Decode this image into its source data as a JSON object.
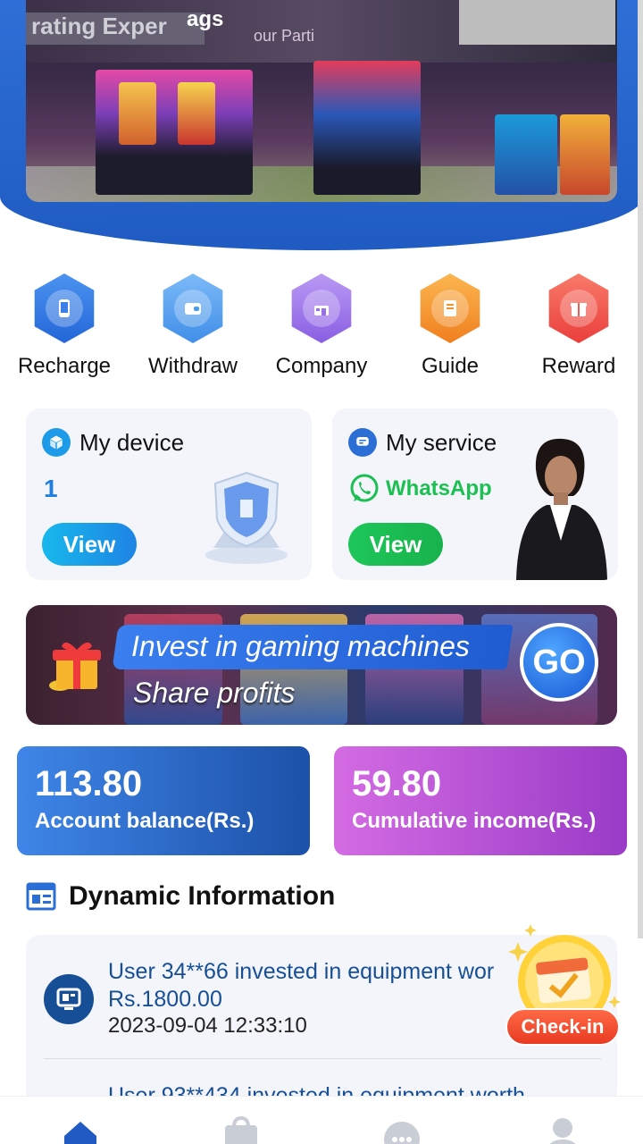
{
  "hero": {
    "sign_left": "rating Exper",
    "sign_mid": "ags",
    "sign_right": "our Parti"
  },
  "actions": [
    {
      "label": "Recharge",
      "icon": "phone-icon",
      "color": "#2f7de8"
    },
    {
      "label": "Withdraw",
      "icon": "wallet-icon",
      "color": "#4b9bf0"
    },
    {
      "label": "Company",
      "icon": "building-icon",
      "color": "#9a6ee8"
    },
    {
      "label": "Guide",
      "icon": "book-icon",
      "color": "#f5922b"
    },
    {
      "label": "Reward",
      "icon": "gift-icon",
      "color": "#f25a52"
    }
  ],
  "device_card": {
    "title": "My device",
    "count": "1",
    "button": "View"
  },
  "service_card": {
    "title": "My service",
    "channel": "WhatsApp",
    "button": "View"
  },
  "promo": {
    "line1": "Invest in gaming machines",
    "line2": "Share profits",
    "go": "GO"
  },
  "stats": {
    "balance_value": "113.80",
    "balance_label": "Account balance(Rs.)",
    "income_value": "59.80",
    "income_label": "Cumulative income(Rs.)"
  },
  "dynamic": {
    "title": "Dynamic Information",
    "items": [
      {
        "text": "User 34**66 invested in equipment wor",
        "amount": "Rs.1800.00",
        "time": "2023-09-04 12:33:10"
      },
      {
        "text": "User 93**434 invested in equipment worth"
      }
    ]
  },
  "checkin": {
    "label": "Check-in"
  },
  "nav": [
    "home-icon",
    "bag-icon",
    "chat-icon",
    "profile-icon"
  ],
  "colors": {
    "primary": "#1f5bc2",
    "accent_blue": "#1e9be8",
    "accent_green": "#1ec75a",
    "balance_card": "#2563c8",
    "income_card": "#b347d6",
    "feed_text": "#174f97"
  }
}
